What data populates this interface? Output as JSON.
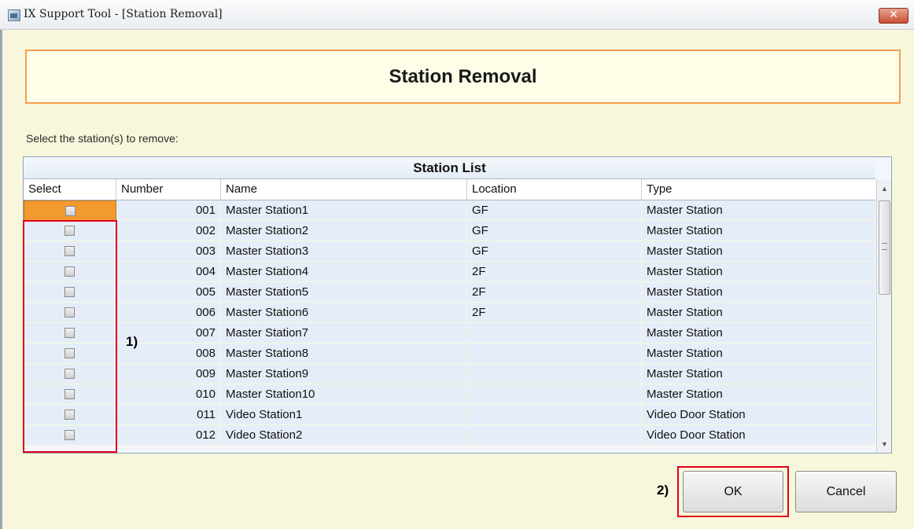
{
  "window": {
    "title": "IX Support Tool - [Station Removal]",
    "close_label": "✕"
  },
  "header": {
    "title": "Station Removal"
  },
  "instruction": "Select the station(s) to remove:",
  "station_list": {
    "title": "Station List",
    "columns": [
      "Select",
      "Number",
      "Name",
      "Location",
      "Type"
    ],
    "rows": [
      {
        "selected": false,
        "number": "001",
        "name": "Master Station1",
        "location": "GF",
        "type": "Master Station"
      },
      {
        "selected": false,
        "number": "002",
        "name": "Master Station2",
        "location": "GF",
        "type": "Master Station"
      },
      {
        "selected": false,
        "number": "003",
        "name": "Master Station3",
        "location": "GF",
        "type": "Master Station"
      },
      {
        "selected": false,
        "number": "004",
        "name": "Master Station4",
        "location": "2F",
        "type": "Master Station"
      },
      {
        "selected": false,
        "number": "005",
        "name": "Master Station5",
        "location": "2F",
        "type": "Master Station"
      },
      {
        "selected": false,
        "number": "006",
        "name": "Master Station6",
        "location": "2F",
        "type": "Master Station"
      },
      {
        "selected": false,
        "number": "007",
        "name": "Master Station7",
        "location": "",
        "type": "Master Station"
      },
      {
        "selected": false,
        "number": "008",
        "name": "Master Station8",
        "location": "",
        "type": "Master Station"
      },
      {
        "selected": false,
        "number": "009",
        "name": "Master Station9",
        "location": "",
        "type": "Master Station"
      },
      {
        "selected": false,
        "number": "010",
        "name": "Master Station10",
        "location": "",
        "type": "Master Station"
      },
      {
        "selected": false,
        "number": "011",
        "name": "Video Station1",
        "location": "",
        "type": "Video Door Station"
      },
      {
        "selected": false,
        "number": "012",
        "name": "Video Station2",
        "location": "",
        "type": "Video Door Station"
      }
    ]
  },
  "scrollbar": {
    "up": "▲",
    "down": "▼"
  },
  "callouts": {
    "one": "1)",
    "two": "2)"
  },
  "buttons": {
    "ok": "OK",
    "cancel": "Cancel"
  },
  "colors": {
    "background": "#f8f7dc",
    "header_border": "#f2a04d",
    "highlight": "#e2001a",
    "row_bg": "#e5eef8",
    "focused_cell": "#f39a2e"
  }
}
